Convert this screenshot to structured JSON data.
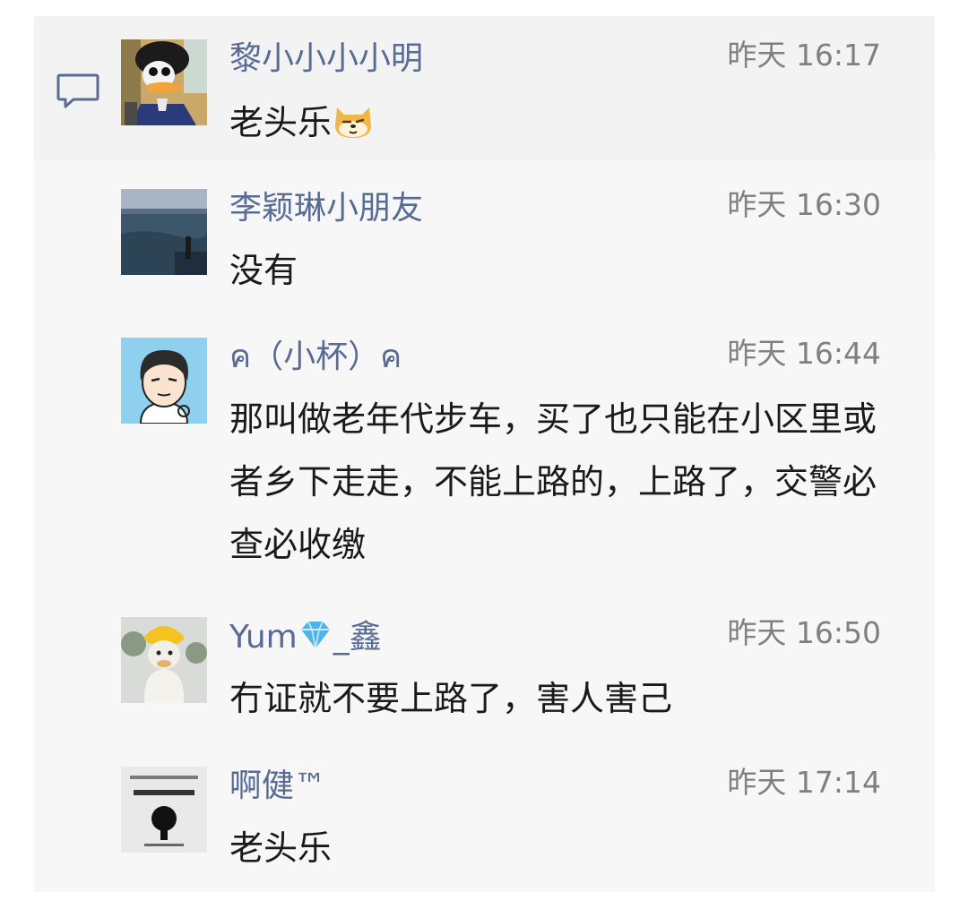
{
  "comments": [
    {
      "name": "黎小小小小明",
      "time": "昨天 16:17",
      "text": "老头乐",
      "emoji": "doge-emoji"
    },
    {
      "name": "李颖琳小朋友",
      "time": "昨天 16:30",
      "text": "没有"
    },
    {
      "name": "ค（小杯）ค",
      "time": "昨天 16:44",
      "text": "那叫做老年代步车，买了也只能在小区里或者乡下走走，不能上路的，上路了，交警必查必收缴"
    },
    {
      "name_prefix": "Yum",
      "name_suffix": "_鑫",
      "name_emoji": "gem-emoji",
      "time": "昨天 16:50",
      "text": "冇证就不要上路了，害人害己"
    },
    {
      "name": "啊健™",
      "time": "昨天 17:14",
      "text": "老头乐"
    }
  ],
  "colors": {
    "name": "#576b95",
    "time": "#808080",
    "text": "#1a1a1a",
    "panel": "#f7f7f7"
  }
}
